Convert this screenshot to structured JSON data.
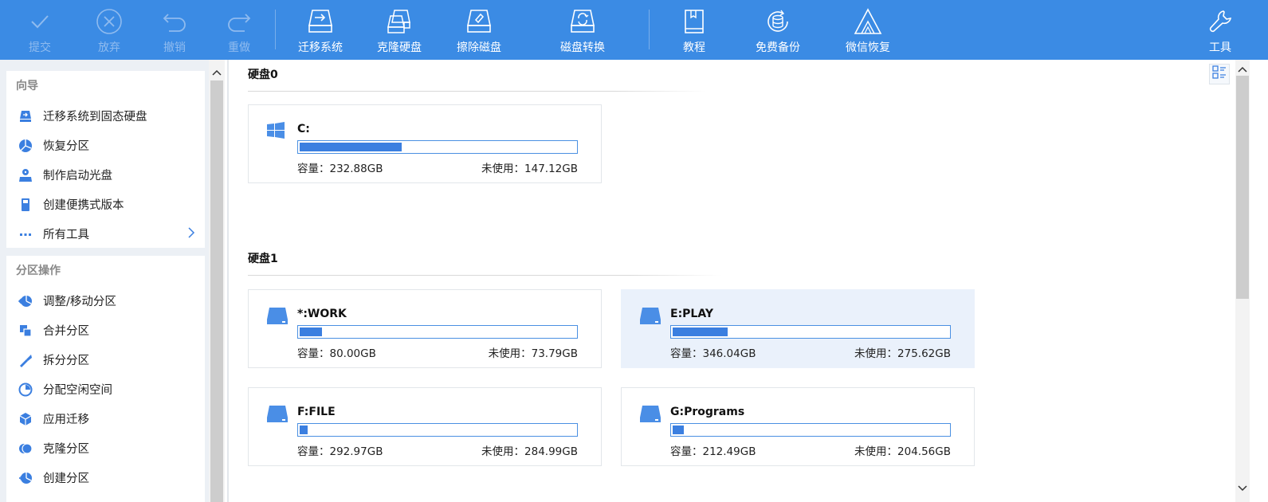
{
  "toolbar": {
    "commit": "提交",
    "discard": "放弃",
    "undo": "撤销",
    "redo": "重做",
    "migrate": "迁移系统",
    "clone": "克隆硬盘",
    "wipe": "擦除磁盘",
    "convert": "磁盘转换",
    "tutorial": "教程",
    "backup": "免费备份",
    "wechat": "微信恢复",
    "tools": "工具"
  },
  "sidebar": {
    "wizard_title": "向导",
    "wizard_items": [
      {
        "label": "迁移系统到固态硬盘",
        "icon": "migrate-ssd-icon"
      },
      {
        "label": "恢复分区",
        "icon": "recover-partition-icon"
      },
      {
        "label": "制作启动光盘",
        "icon": "boot-disc-icon"
      },
      {
        "label": "创建便携式版本",
        "icon": "portable-icon"
      },
      {
        "label": "所有工具",
        "icon": "more-icon"
      }
    ],
    "partition_title": "分区操作",
    "partition_items": [
      {
        "label": "调整/移动分区",
        "icon": "resize-icon"
      },
      {
        "label": "合并分区",
        "icon": "merge-icon"
      },
      {
        "label": "拆分分区",
        "icon": "split-icon"
      },
      {
        "label": "分配空闲空间",
        "icon": "allocate-icon"
      },
      {
        "label": "应用迁移",
        "icon": "app-migrate-icon"
      },
      {
        "label": "克隆分区",
        "icon": "clone-partition-icon"
      },
      {
        "label": "创建分区",
        "icon": "create-partition-icon"
      }
    ]
  },
  "main": {
    "capacity_label": "容量：",
    "free_label": "未使用：",
    "disks": [
      {
        "title": "硬盘0",
        "partitions": [
          {
            "name": "C:",
            "capacity": "232.88GB",
            "free": "147.12GB",
            "used_fraction": 0.37,
            "icon": "windows-icon",
            "selected": false
          }
        ]
      },
      {
        "title": "硬盘1",
        "partitions": [
          {
            "name": "*:WORK",
            "capacity": "80.00GB",
            "free": "73.79GB",
            "used_fraction": 0.08,
            "icon": "drive-icon",
            "selected": false
          },
          {
            "name": "E:PLAY",
            "capacity": "346.04GB",
            "free": "275.62GB",
            "used_fraction": 0.2,
            "icon": "drive-icon",
            "selected": true
          },
          {
            "name": "F:FILE",
            "capacity": "292.97GB",
            "free": "284.99GB",
            "used_fraction": 0.03,
            "icon": "drive-icon",
            "selected": false
          },
          {
            "name": "G:Programs",
            "capacity": "212.49GB",
            "free": "204.56GB",
            "used_fraction": 0.04,
            "icon": "drive-icon",
            "selected": false
          }
        ]
      }
    ]
  },
  "colors": {
    "toolbar_bg": "#3b8be4",
    "accent": "#3b7fe0",
    "selected_card": "#eaf1fb"
  }
}
